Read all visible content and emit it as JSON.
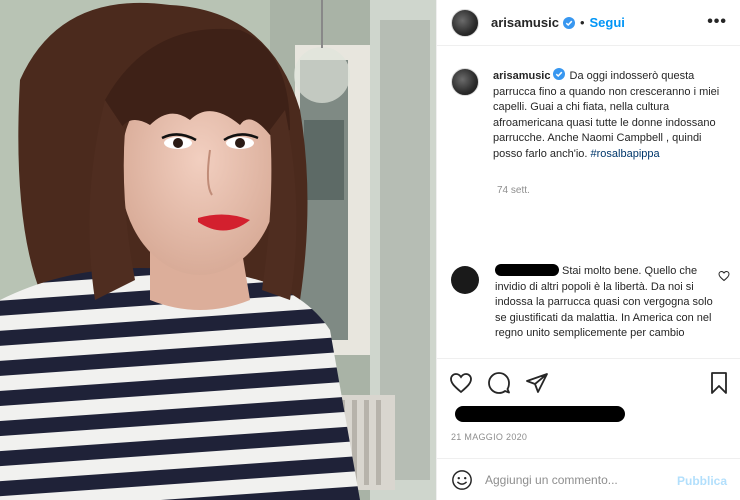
{
  "post": {
    "username": "arisamusic",
    "follow_label": "Segui",
    "more_label": "•••",
    "caption_username": "arisamusic",
    "caption_body": " Da oggi indosserò questa parrucca fino a quando non cresceranno i miei capelli. Guai a chi fiata, nella cultura afroamericana quasi tutte le donne indossano parrucche. Anche Naomi Campbell , quindi posso farlo anch'io. ",
    "hashtag": "#rosalbapippa",
    "caption_time": "74 sett.",
    "comment_text": "Stai molto bene. Quello che invidio di altri popoli è la libertà. Da noi si indossa la parrucca quasi con vergogna solo se giustificati da malattia. In America con nel regno unito semplicemente per cambio",
    "date": "21 MAGGIO 2020"
  },
  "add_comment": {
    "placeholder": "Aggiungi un commento...",
    "publish_label": "Pubblica"
  },
  "icons": [
    "verified-badge",
    "heart-icon",
    "comment-icon",
    "share-icon",
    "bookmark-icon",
    "emoji-icon"
  ],
  "colors": {
    "link": "#0095f6",
    "hashtag": "#00376b",
    "muted": "#8e8e8e",
    "publish_disabled": "#b2dffc"
  }
}
